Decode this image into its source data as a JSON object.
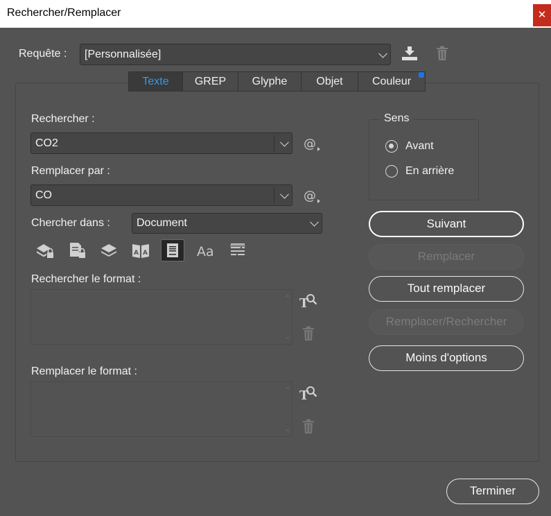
{
  "window": {
    "title": "Rechercher/Remplacer",
    "close_glyph": "✕"
  },
  "query": {
    "label": "Requête :",
    "value": "[Personnalisée]",
    "save_icon": "save-query-icon",
    "delete_icon": "trash-icon"
  },
  "tabs": [
    {
      "label": "Texte",
      "active": true
    },
    {
      "label": "GREP",
      "active": false
    },
    {
      "label": "Glyphe",
      "active": false
    },
    {
      "label": "Objet",
      "active": false
    },
    {
      "label": "Couleur",
      "active": false
    }
  ],
  "search": {
    "label": "Rechercher :",
    "value": "CO2"
  },
  "replace": {
    "label": "Remplacer par :",
    "value": "CO"
  },
  "scope": {
    "label": "Chercher dans :",
    "value": "Document"
  },
  "find_format": {
    "label": "Rechercher le format :"
  },
  "change_format": {
    "label": "Remplacer le format :"
  },
  "direction": {
    "legend": "Sens",
    "options": [
      {
        "label": "Avant",
        "selected": true
      },
      {
        "label": "En arrière",
        "selected": false
      }
    ]
  },
  "buttons": {
    "next": "Suivant",
    "replace": "Remplacer",
    "replace_all": "Tout remplacer",
    "replace_find": "Remplacer/Rechercher",
    "fewer_options": "Moins d'options",
    "done": "Terminer"
  },
  "colors": {
    "accent": "#2d9cf0",
    "dot": "#1e73e8",
    "close": "#c42b1c",
    "background": "#535353"
  }
}
